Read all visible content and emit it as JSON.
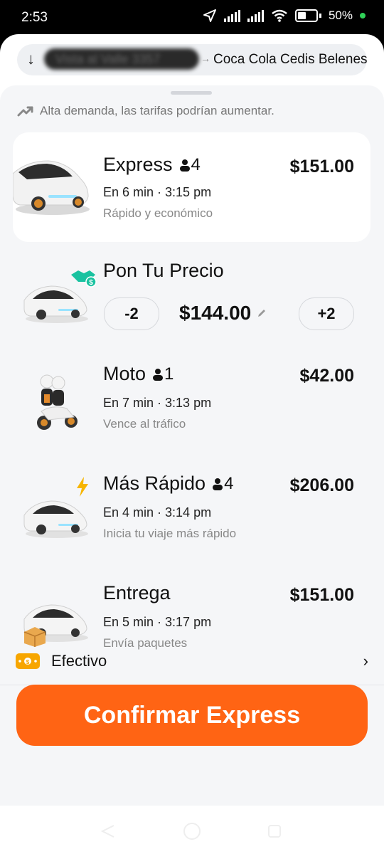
{
  "status": {
    "time": "2:53",
    "battery": "50%"
  },
  "route": {
    "from": "Vista al Valle 3357",
    "to": "Coca Cola Cedis Belenes"
  },
  "demand_notice": "Alta demanda, las tarifas podrían aumentar.",
  "options": [
    {
      "name": "Express",
      "seats": "4",
      "eta": "En 6 min · 3:15 pm",
      "desc": "Rápido y económico",
      "price": "$151.00"
    },
    {
      "name": "Pon Tu Precio",
      "minus": "-2",
      "price": "$144.00",
      "plus": "+2"
    },
    {
      "name": "Moto",
      "seats": "1",
      "eta": "En 7 min · 3:13 pm",
      "desc": "Vence al tráfico",
      "price": "$42.00"
    },
    {
      "name": "Más Rápido",
      "seats": "4",
      "eta": "En 4 min · 3:14 pm",
      "desc": "Inicia tu viaje más rápido",
      "price": "$206.00"
    },
    {
      "name": "Entrega",
      "eta": "En 5 min · 3:17 pm",
      "desc": "Envía paquetes",
      "price": "$151.00"
    }
  ],
  "payment": {
    "method": "Efectivo"
  },
  "confirm_label": "Confirmar Express",
  "colors": {
    "accent": "#ff6414",
    "cash": "#f7a600",
    "bolt": "#f7b500",
    "deal": "#19c2a0"
  }
}
